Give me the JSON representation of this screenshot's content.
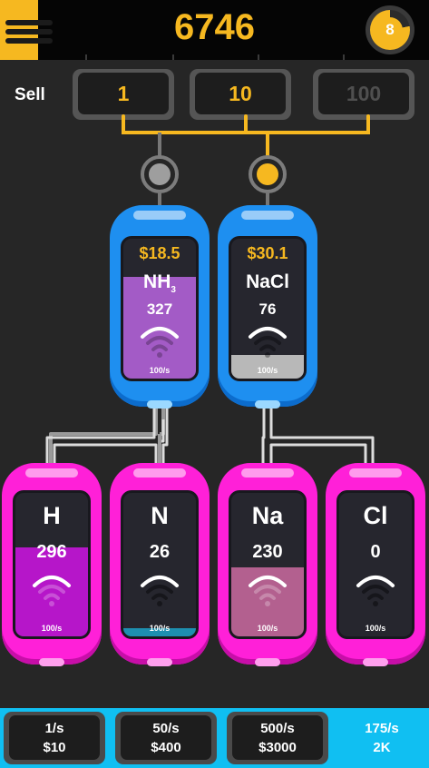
{
  "header": {
    "score": "6746",
    "level": "8",
    "level_progress": 0.78,
    "accent_color": "#f6b820"
  },
  "sell": {
    "label": "Sell",
    "options": [
      "1",
      "10",
      "100"
    ],
    "selected": "1",
    "disabled": [
      "100"
    ]
  },
  "compounds": [
    {
      "price": "$18.5",
      "symbol": "NH",
      "subscript": "3",
      "count": "327",
      "rate": "100/s",
      "fill_level": 0.73,
      "fill_color": "#a35bc6"
    },
    {
      "price": "$30.1",
      "symbol": "NaCl",
      "subscript": "",
      "count": "76",
      "rate": "100/s",
      "fill_level": 0.17,
      "fill_color": "#b8b8b8"
    }
  ],
  "elements": [
    {
      "symbol": "H",
      "count": "296",
      "rate": "100/s",
      "fill_level": 0.62,
      "fill_color": "#b616c9"
    },
    {
      "symbol": "N",
      "count": "26",
      "rate": "100/s",
      "fill_level": 0.06,
      "fill_color": "#1e8fb0"
    },
    {
      "symbol": "Na",
      "count": "230",
      "rate": "100/s",
      "fill_level": 0.48,
      "fill_color": "#b3608f"
    },
    {
      "symbol": "Cl",
      "count": "0",
      "rate": "100/s",
      "fill_level": 0.0,
      "fill_color": "#26262e"
    }
  ],
  "upgrades": [
    {
      "rate": "1/s",
      "cost": "$10"
    },
    {
      "rate": "50/s",
      "cost": "$400"
    },
    {
      "rate": "500/s",
      "cost": "$3000"
    }
  ],
  "total": {
    "rate": "175/s",
    "value": "2K"
  }
}
